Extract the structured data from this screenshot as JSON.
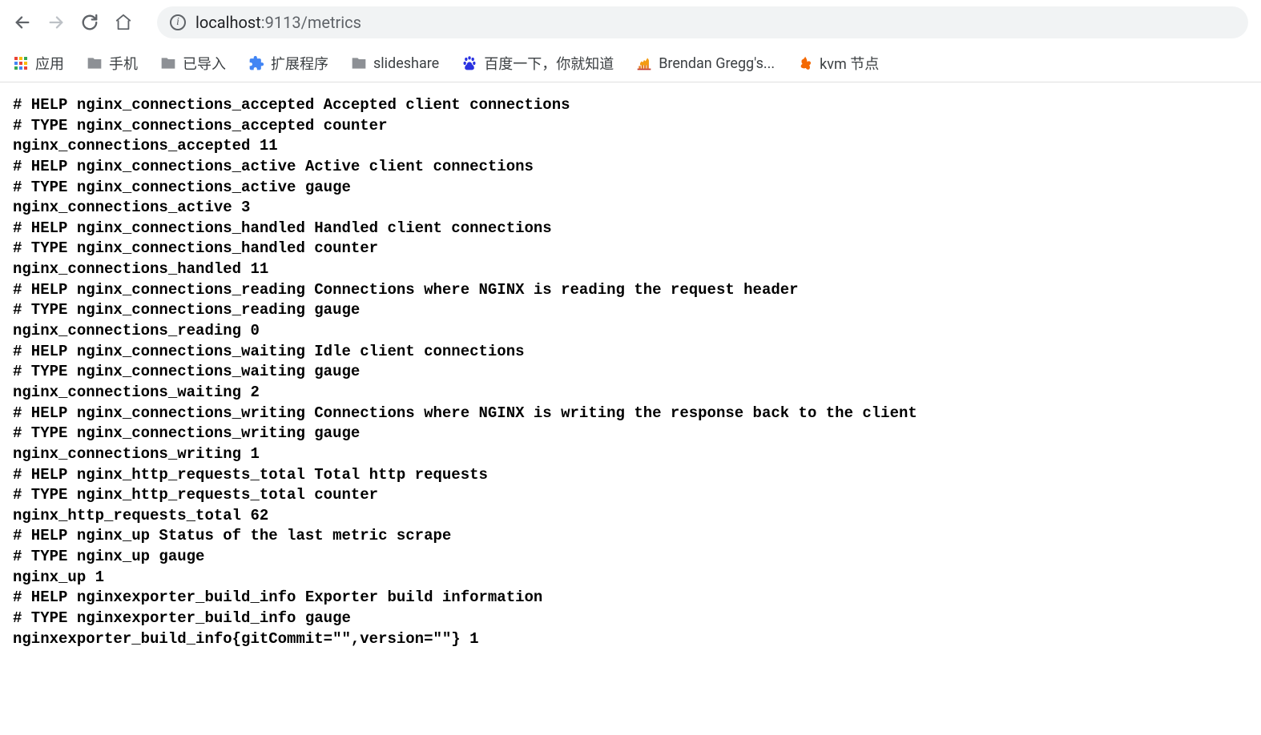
{
  "url": {
    "host": "localhost",
    "port_path": ":9113/metrics"
  },
  "bookmarks": [
    {
      "label": "应用",
      "icon": "apps"
    },
    {
      "label": "手机",
      "icon": "folder"
    },
    {
      "label": "已导入",
      "icon": "folder"
    },
    {
      "label": "扩展程序",
      "icon": "puzzle"
    },
    {
      "label": "slideshare",
      "icon": "folder"
    },
    {
      "label": "百度一下，你就知道",
      "icon": "baidu"
    },
    {
      "label": "Brendan Gregg's...",
      "icon": "flame"
    },
    {
      "label": "kvm 节点",
      "icon": "grafana"
    }
  ],
  "metrics": [
    "# HELP nginx_connections_accepted Accepted client connections",
    "# TYPE nginx_connections_accepted counter",
    "nginx_connections_accepted 11",
    "# HELP nginx_connections_active Active client connections",
    "# TYPE nginx_connections_active gauge",
    "nginx_connections_active 3",
    "# HELP nginx_connections_handled Handled client connections",
    "# TYPE nginx_connections_handled counter",
    "nginx_connections_handled 11",
    "# HELP nginx_connections_reading Connections where NGINX is reading the request header",
    "# TYPE nginx_connections_reading gauge",
    "nginx_connections_reading 0",
    "# HELP nginx_connections_waiting Idle client connections",
    "# TYPE nginx_connections_waiting gauge",
    "nginx_connections_waiting 2",
    "# HELP nginx_connections_writing Connections where NGINX is writing the response back to the client",
    "# TYPE nginx_connections_writing gauge",
    "nginx_connections_writing 1",
    "# HELP nginx_http_requests_total Total http requests",
    "# TYPE nginx_http_requests_total counter",
    "nginx_http_requests_total 62",
    "# HELP nginx_up Status of the last metric scrape",
    "# TYPE nginx_up gauge",
    "nginx_up 1",
    "# HELP nginxexporter_build_info Exporter build information",
    "# TYPE nginxexporter_build_info gauge",
    "nginxexporter_build_info{gitCommit=\"\",version=\"\"} 1"
  ]
}
